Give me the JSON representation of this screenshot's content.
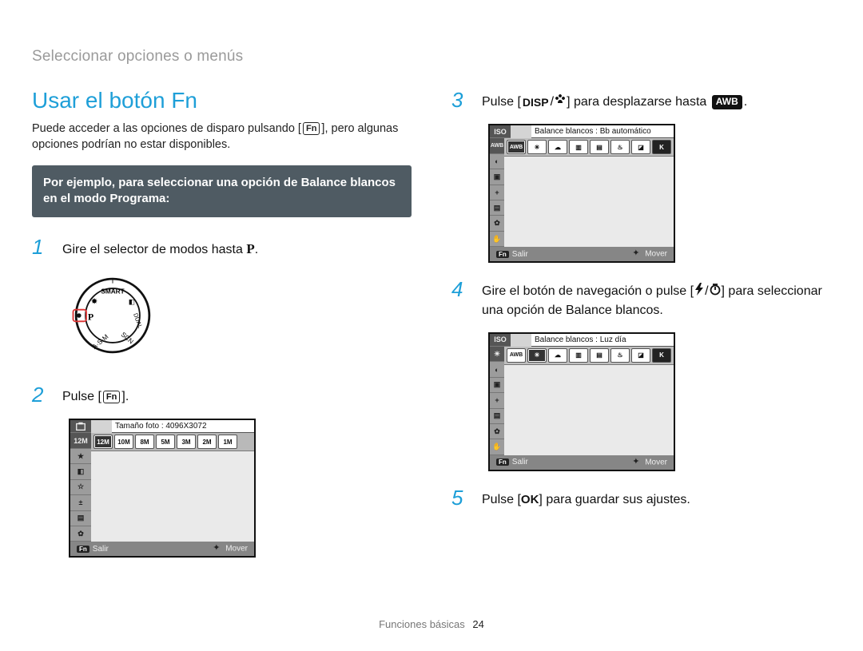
{
  "breadcrumb": "Seleccionar opciones o menús",
  "section_title": "Usar el botón Fn",
  "intro_parts": {
    "a": "Puede acceder a las opciones de disparo pulsando [",
    "b": "], pero algunas opciones podrían no estar disponibles."
  },
  "fn_label": "Fn",
  "callout": "Por ejemplo, para seleccionar una opción de Balance blancos en el modo Programa:",
  "steps": {
    "s1": {
      "num": "1",
      "text_a": "Gire el selector de modos hasta ",
      "mode": "P",
      "text_b": "."
    },
    "s2": {
      "num": "2",
      "text_a": "Pulse [",
      "text_b": "]."
    },
    "s3": {
      "num": "3",
      "text_a": "Pulse [",
      "mid": "/",
      "text_b": "] para desplazarse hasta ",
      "text_c": "."
    },
    "s4": {
      "num": "4",
      "text_a": "Gire el botón de navegación o pulse [",
      "mid": "/",
      "text_b": "] para seleccionar una opción de Balance blancos."
    },
    "s5": {
      "num": "5",
      "text_a": "Pulse [",
      "text_b": "] para guardar sus ajustes."
    }
  },
  "icons": {
    "disp": "DISP",
    "ok": "OK",
    "awb": "AWB"
  },
  "lcd1": {
    "title": "Tamaño foto : 4096X3072",
    "options": [
      "12M",
      "10M",
      "8M",
      "5M",
      "3M",
      "2M",
      "1M"
    ],
    "footer_left": "Salir",
    "footer_right": "Mover",
    "footer_chip": "Fn"
  },
  "lcd2": {
    "title": "Balance blancos : Bb automático",
    "footer_left": "Salir",
    "footer_right": "Mover",
    "footer_chip": "Fn"
  },
  "lcd3": {
    "title": "Balance blancos : Luz día",
    "footer_left": "Salir",
    "footer_right": "Mover",
    "footer_chip": "Fn"
  },
  "footer": {
    "label": "Funciones básicas",
    "page": "24"
  }
}
